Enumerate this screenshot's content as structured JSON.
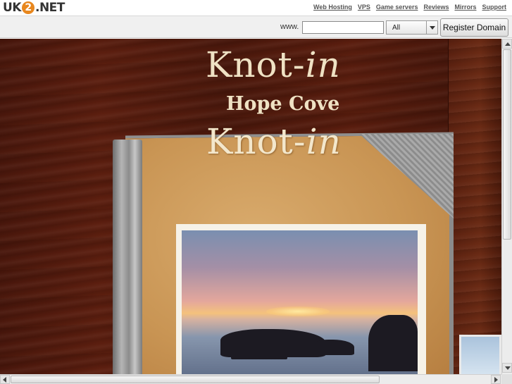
{
  "header": {
    "logo_prefix": "UK",
    "logo_digit": "2",
    "logo_suffix": ".NET",
    "nav": [
      "Web Hosting",
      "VPS",
      "Game servers",
      "Reviews",
      "Mirrors",
      "Support"
    ]
  },
  "search": {
    "prefix": "www.",
    "input_value": "",
    "tld_selected": "All",
    "register_label": "Register Domain"
  },
  "site": {
    "title_main": "Knot-",
    "title_italic": "in",
    "subtitle": "Hope Cove",
    "book_title_main": "Knot-",
    "book_title_italic": "in"
  },
  "colors": {
    "brand_orange": "#e8871e",
    "wood": "#4a170c",
    "title_cream": "#efe2c4",
    "book_leather": "#c99554"
  },
  "icons": [
    "dropdown-arrow-icon",
    "scroll-up-icon",
    "scroll-down-icon",
    "scroll-left-icon",
    "scroll-right-icon"
  ]
}
